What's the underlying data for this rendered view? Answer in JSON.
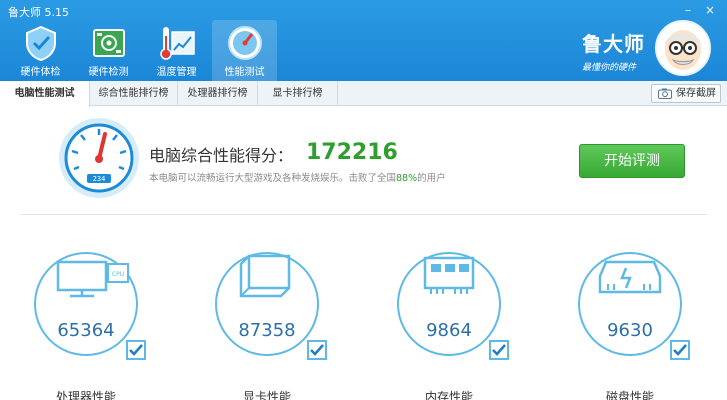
{
  "app": {
    "title": "鲁大师 5.15"
  },
  "window_controls": {
    "minimize": "–",
    "close": "×"
  },
  "nav": [
    {
      "label": "硬件体检",
      "icon": "shield-check-icon"
    },
    {
      "label": "硬件检测",
      "icon": "circuit-board-icon"
    },
    {
      "label": "温度管理",
      "icon": "thermometer-chart-icon"
    },
    {
      "label": "性能测试",
      "icon": "speedometer-icon",
      "active": true
    }
  ],
  "brand": {
    "name": "鲁大师",
    "slogan": "最懂你的硬件"
  },
  "tabs": [
    {
      "label": "电脑性能测试",
      "active": true
    },
    {
      "label": "综合性能排行榜"
    },
    {
      "label": "处理器排行榜"
    },
    {
      "label": "显卡排行榜"
    }
  ],
  "screenshot_button": {
    "label": "保存截屏"
  },
  "score": {
    "label": "电脑综合性能得分：",
    "value": "172216",
    "desc_prefix": "本电脑可以流畅运行大型游戏及各种发烧娱乐。击败了全国",
    "desc_percent": "88%",
    "desc_suffix": "的用户",
    "gauge_reading": "234"
  },
  "start_button": {
    "label": "开始评测"
  },
  "components": [
    {
      "value": "65364",
      "label": "处理器性能",
      "icon": "cpu-monitor-icon"
    },
    {
      "value": "87358",
      "label": "显卡性能",
      "icon": "graphics-card-icon"
    },
    {
      "value": "9864",
      "label": "内存性能",
      "icon": "memory-chip-icon"
    },
    {
      "value": "9630",
      "label": "磁盘性能",
      "icon": "hard-drive-icon"
    }
  ],
  "colors": {
    "header_blue": "#1c86d6",
    "score_green": "#2f9e2f",
    "circle_blue": "#5fb9e6"
  }
}
